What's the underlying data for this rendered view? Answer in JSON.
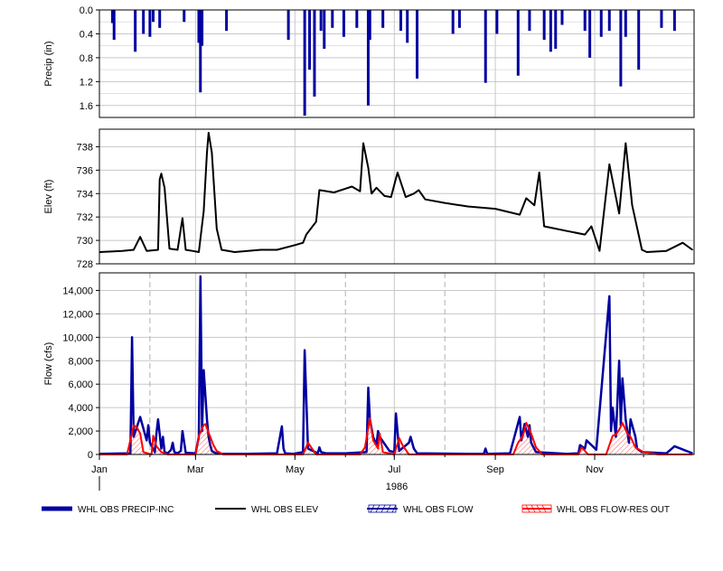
{
  "chart_data": [
    {
      "type": "bar",
      "ylabel": "Precip (in)",
      "ylim": [
        0,
        1.8
      ],
      "y_inverted": true,
      "yticks": [
        "0.0",
        "0.4",
        "0.8",
        "1.2",
        "1.6"
      ],
      "ytick_values": [
        0,
        0.4,
        0.8,
        1.2,
        1.6
      ],
      "grid": true,
      "series": [
        {
          "name": "WHL OBS PRECIP-INC",
          "color": "#0000a0",
          "x": [
            "1986-01-09",
            "1986-01-10",
            "1986-01-23",
            "1986-01-28",
            "1986-02-01",
            "1986-02-03",
            "1986-02-07",
            "1986-02-22",
            "1986-03-03",
            "1986-03-04",
            "1986-03-05",
            "1986-03-20",
            "1986-04-27",
            "1986-05-07",
            "1986-05-10",
            "1986-05-13",
            "1986-05-17",
            "1986-05-19",
            "1986-05-24",
            "1986-05-31",
            "1986-06-08",
            "1986-06-15",
            "1986-06-16",
            "1986-06-24",
            "1986-07-05",
            "1986-07-09",
            "1986-07-15",
            "1986-08-06",
            "1986-08-10",
            "1986-08-26",
            "1986-09-02",
            "1986-09-15",
            "1986-09-22",
            "1986-10-01",
            "1986-10-05",
            "1986-10-08",
            "1986-10-12",
            "1986-10-26",
            "1986-10-29",
            "1986-11-05",
            "1986-11-10",
            "1986-11-17",
            "1986-11-20",
            "1986-11-28",
            "1986-12-12",
            "1986-12-20"
          ],
          "values": [
            0.22,
            0.5,
            0.7,
            0.4,
            0.45,
            0.2,
            0.3,
            0.2,
            0.55,
            1.38,
            0.6,
            0.35,
            0.5,
            1.77,
            1.0,
            1.45,
            0.35,
            0.65,
            0.3,
            0.45,
            0.3,
            1.6,
            0.5,
            0.3,
            0.35,
            0.55,
            1.15,
            0.4,
            0.3,
            1.22,
            0.4,
            1.1,
            0.35,
            0.5,
            0.7,
            0.65,
            0.25,
            0.35,
            0.8,
            0.45,
            0.35,
            1.28,
            0.45,
            1.0,
            0.3,
            0.35
          ]
        }
      ]
    },
    {
      "type": "line",
      "ylabel": "Elev (ft)",
      "ylim": [
        728,
        739.5
      ],
      "yticks": [
        "728",
        "730",
        "732",
        "734",
        "736",
        "738"
      ],
      "ytick_values": [
        728,
        730,
        732,
        734,
        736,
        738
      ],
      "grid": true,
      "series": [
        {
          "name": "WHL OBS ELEV",
          "color": "#000000",
          "x": [
            "1986-01-01",
            "1986-01-15",
            "1986-01-22",
            "1986-01-26",
            "1986-01-30",
            "1986-02-06",
            "1986-02-07",
            "1986-02-08",
            "1986-02-10",
            "1986-02-13",
            "1986-02-18",
            "1986-02-21",
            "1986-02-23",
            "1986-02-27",
            "1986-03-03",
            "1986-03-06",
            "1986-03-08",
            "1986-03-09",
            "1986-03-11",
            "1986-03-14",
            "1986-03-17",
            "1986-03-25",
            "1986-04-10",
            "1986-04-20",
            "1986-05-01",
            "1986-05-06",
            "1986-05-08",
            "1986-05-14",
            "1986-05-16",
            "1986-05-25",
            "1986-06-05",
            "1986-06-10",
            "1986-06-12",
            "1986-06-15",
            "1986-06-17",
            "1986-06-20",
            "1986-06-25",
            "1986-06-29",
            "1986-07-03",
            "1986-07-08",
            "1986-07-13",
            "1986-07-16",
            "1986-07-20",
            "1986-08-01",
            "1986-08-15",
            "1986-09-01",
            "1986-09-16",
            "1986-09-20",
            "1986-09-25",
            "1986-09-28",
            "1986-10-01",
            "1986-10-15",
            "1986-10-26",
            "1986-10-30",
            "1986-11-04",
            "1986-11-10",
            "1986-11-16",
            "1986-11-20",
            "1986-11-24",
            "1986-11-30",
            "1986-12-03",
            "1986-12-15",
            "1986-12-25",
            "1986-12-31"
          ],
          "values": [
            729.0,
            729.1,
            729.2,
            730.3,
            729.1,
            729.2,
            735.2,
            735.7,
            734.5,
            729.3,
            729.2,
            731.9,
            729.2,
            729.1,
            729.0,
            732.5,
            737.5,
            739.2,
            737.5,
            731.0,
            729.2,
            729.0,
            729.2,
            729.2,
            729.6,
            729.8,
            730.5,
            731.6,
            734.3,
            734.1,
            734.6,
            734.2,
            738.3,
            736.2,
            734.0,
            734.5,
            733.8,
            733.7,
            735.8,
            733.7,
            734.0,
            734.3,
            733.5,
            733.2,
            732.9,
            732.7,
            732.2,
            733.6,
            733.0,
            735.8,
            731.2,
            730.8,
            730.5,
            731.2,
            729.1,
            736.5,
            732.3,
            738.3,
            733.0,
            729.2,
            729.0,
            729.1,
            729.8,
            729.2
          ]
        }
      ]
    },
    {
      "type": "line",
      "ylabel": "Flow (cfs)",
      "ylim": [
        0,
        15500
      ],
      "yticks": [
        "0",
        "2,000",
        "4,000",
        "6,000",
        "8,000",
        "10,000",
        "12,000",
        "14,000"
      ],
      "ytick_values": [
        0,
        2000,
        4000,
        6000,
        8000,
        10000,
        12000,
        14000
      ],
      "xlabel": "1986",
      "xticks": [
        "Jan",
        "Mar",
        "May",
        "Jul",
        "Sep",
        "Nov"
      ],
      "xtick_values": [
        "1986-01-01",
        "1986-03-01",
        "1986-05-01",
        "1986-07-01",
        "1986-09-01",
        "1986-11-01"
      ],
      "xgrid_dates": [
        "1986-02-01",
        "1986-04-01",
        "1986-06-01",
        "1986-08-01",
        "1986-10-01",
        "1986-12-01"
      ],
      "grid": true,
      "series": [
        {
          "name": "WHL OBS FLOW",
          "color": "#0000a0",
          "x": [
            "1986-01-01",
            "1986-01-20",
            "1986-01-21",
            "1986-01-22",
            "1986-01-26",
            "1986-01-30",
            "1986-01-31",
            "1986-02-01",
            "1986-02-04",
            "1986-02-05",
            "1986-02-06",
            "1986-02-08",
            "1986-02-09",
            "1986-02-10",
            "1986-02-12",
            "1986-02-14",
            "1986-02-15",
            "1986-02-16",
            "1986-02-18",
            "1986-02-20",
            "1986-02-21",
            "1986-02-23",
            "1986-03-01",
            "1986-03-03",
            "1986-03-04",
            "1986-03-05",
            "1986-03-06",
            "1986-03-08",
            "1986-03-09",
            "1986-03-10",
            "1986-03-11",
            "1986-03-12",
            "1986-03-14",
            "1986-03-18",
            "1986-04-01",
            "1986-04-20",
            "1986-04-23",
            "1986-04-24",
            "1986-04-25",
            "1986-04-30",
            "1986-05-06",
            "1986-05-07",
            "1986-05-09",
            "1986-05-15",
            "1986-05-16",
            "1986-05-17",
            "1986-05-20",
            "1986-06-01",
            "1986-06-14",
            "1986-06-15",
            "1986-06-16",
            "1986-06-18",
            "1986-06-20",
            "1986-06-21",
            "1986-06-22",
            "1986-06-28",
            "1986-07-01",
            "1986-07-02",
            "1986-07-04",
            "1986-07-10",
            "1986-07-11",
            "1986-07-13",
            "1986-07-15",
            "1986-08-15",
            "1986-08-25",
            "1986-08-26",
            "1986-08-27",
            "1986-09-10",
            "1986-09-16",
            "1986-09-17",
            "1986-09-19",
            "1986-09-21",
            "1986-09-22",
            "1986-09-23",
            "1986-09-26",
            "1986-10-15",
            "1986-10-22",
            "1986-10-23",
            "1986-10-26",
            "1986-10-27",
            "1986-11-02",
            "1986-11-10",
            "1986-11-11",
            "1986-11-12",
            "1986-11-14",
            "1986-11-16",
            "1986-11-17",
            "1986-11-18",
            "1986-11-20",
            "1986-11-21",
            "1986-11-22",
            "1986-11-23",
            "1986-11-26",
            "1986-11-27",
            "1986-11-30",
            "1986-12-15",
            "1986-12-20",
            "1986-12-31"
          ],
          "values": [
            50,
            100,
            10000,
            1500,
            3200,
            1200,
            2500,
            1000,
            200,
            1800,
            3000,
            500,
            1500,
            200,
            100,
            400,
            1000,
            200,
            100,
            300,
            2000,
            150,
            100,
            1500,
            15200,
            2000,
            7200,
            3000,
            1500,
            800,
            300,
            200,
            100,
            50,
            50,
            100,
            2400,
            500,
            100,
            50,
            200,
            8900,
            500,
            100,
            600,
            200,
            100,
            100,
            200,
            5700,
            3000,
            1500,
            800,
            2000,
            1500,
            300,
            200,
            3500,
            300,
            1000,
            1500,
            500,
            100,
            50,
            50,
            500,
            50,
            100,
            3200,
            1200,
            2600,
            1500,
            2500,
            1000,
            200,
            50,
            100,
            800,
            500,
            1200,
            400,
            13500,
            2000,
            4000,
            1500,
            8000,
            2500,
            6500,
            3000,
            2000,
            1000,
            3000,
            1500,
            500,
            200,
            100,
            700,
            100
          ]
        },
        {
          "name": "WHL OBS FLOW-RES OUT",
          "color": "#ff0000",
          "x": [
            "1986-01-01",
            "1986-01-18",
            "1986-01-19",
            "1986-01-22",
            "1986-01-24",
            "1986-01-26",
            "1986-01-28",
            "1986-02-02",
            "1986-02-03",
            "1986-02-05",
            "1986-02-08",
            "1986-02-12",
            "1986-03-01",
            "1986-03-03",
            "1986-03-06",
            "1986-03-07",
            "1986-03-10",
            "1986-03-12",
            "1986-03-14",
            "1986-03-18",
            "1986-04-01",
            "1986-05-06",
            "1986-05-09",
            "1986-05-12",
            "1986-05-14",
            "1986-06-10",
            "1986-06-13",
            "1986-06-16",
            "1986-06-18",
            "1986-06-21",
            "1986-06-22",
            "1986-06-24",
            "1986-07-01",
            "1986-07-04",
            "1986-07-06",
            "1986-07-10",
            "1986-09-12",
            "1986-09-15",
            "1986-09-18",
            "1986-09-20",
            "1986-09-23",
            "1986-09-26",
            "1986-09-30",
            "1986-10-22",
            "1986-10-24",
            "1986-10-28",
            "1986-11-08",
            "1986-11-10",
            "1986-11-12",
            "1986-11-14",
            "1986-11-16",
            "1986-11-18",
            "1986-11-21",
            "1986-11-23",
            "1986-11-26",
            "1986-12-01",
            "1986-12-10",
            "1986-12-31"
          ],
          "values": [
            0,
            0,
            600,
            2500,
            2300,
            1800,
            200,
            0,
            1600,
            700,
            200,
            0,
            0,
            1600,
            2500,
            2600,
            1500,
            800,
            300,
            0,
            0,
            0,
            1000,
            400,
            0,
            0,
            600,
            3100,
            1200,
            500,
            1800,
            200,
            0,
            1400,
            800,
            0,
            0,
            1000,
            1600,
            2700,
            1800,
            600,
            0,
            0,
            600,
            0,
            0,
            800,
            1600,
            1700,
            2100,
            2700,
            1800,
            1500,
            600,
            200,
            0,
            0
          ]
        }
      ]
    }
  ],
  "legend": {
    "items": [
      {
        "label": "WHL OBS PRECIP-INC",
        "color": "#0000a0"
      },
      {
        "label": "WHL OBS ELEV",
        "color": "#000000"
      },
      {
        "label": "WHL OBS FLOW",
        "color": "#0000a0"
      },
      {
        "label": "WHL OBS FLOW-RES OUT",
        "color": "#ff0000"
      }
    ]
  }
}
